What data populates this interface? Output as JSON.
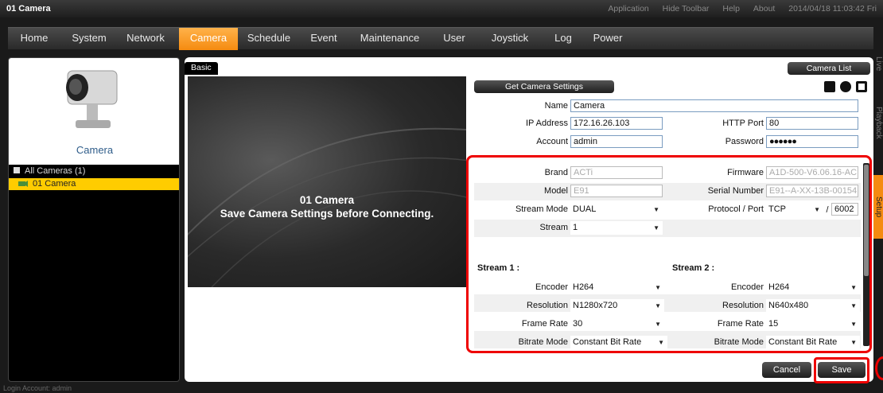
{
  "window": {
    "title": "01 Camera"
  },
  "toolbar_links": [
    "Application",
    "Hide Toolbar",
    "Help",
    "About"
  ],
  "datetime": "2014/04/18 11:03:42 Fri",
  "menu": [
    "Home",
    "System",
    "Network",
    "Camera",
    "Schedule",
    "Event",
    "Maintenance",
    "User",
    "Joystick",
    "Log",
    "Power"
  ],
  "active_menu": "Camera",
  "sidebar": {
    "camera_label": "Camera",
    "tree_root": "All Cameras (1)",
    "tree_item": "01  Camera"
  },
  "right_tabs": [
    "Live",
    "Playback",
    "Setup"
  ],
  "active_right_tab": "Setup",
  "basic_tab": "Basic",
  "camera_list_button": "Camera List",
  "preview": {
    "line1": "01 Camera",
    "line2": "Save Camera Settings before Connecting."
  },
  "get_settings_button": "Get Camera Settings",
  "form": {
    "name_label": "Name",
    "name_value": "Camera",
    "ip_label": "IP Address",
    "ip_value": "172.16.26.103",
    "http_port_label": "HTTP Port",
    "http_port_value": "80",
    "account_label": "Account",
    "account_value": "admin",
    "password_label": "Password",
    "password_value": "●●●●●●",
    "brand_label": "Brand",
    "brand_value": "ACTi",
    "firmware_label": "Firmware",
    "firmware_value": "A1D-500-V6.06.16-AC",
    "model_label": "Model",
    "model_value": "E91",
    "serial_label": "Serial Number",
    "serial_value": "E91--A-XX-13B-00154",
    "stream_mode_label": "Stream Mode",
    "stream_mode_value": "DUAL",
    "protocol_label": "Protocol / Port",
    "protocol_value": "TCP",
    "port_sep": "/",
    "port_value": "6002",
    "stream_label": "Stream",
    "stream_value": "1"
  },
  "stream1": {
    "heading": "Stream 1 :",
    "encoder_label": "Encoder",
    "encoder_value": "H264",
    "resolution_label": "Resolution",
    "resolution_value": "N1280x720",
    "framerate_label": "Frame Rate",
    "framerate_value": "30",
    "bitrate_label": "Bitrate Mode",
    "bitrate_value": "Constant Bit Rate"
  },
  "stream2": {
    "heading": "Stream 2 :",
    "encoder_label": "Encoder",
    "encoder_value": "H264",
    "resolution_label": "Resolution",
    "resolution_value": "N640x480",
    "framerate_label": "Frame Rate",
    "framerate_value": "15",
    "bitrate_label": "Bitrate Mode",
    "bitrate_value": "Constant Bit Rate"
  },
  "cancel_button": "Cancel",
  "save_button": "Save",
  "status": {
    "login": "Login Account: admin"
  },
  "colors": {
    "accent": "#f58b10",
    "highlight": "#ffcc00",
    "annotation": "#e00000",
    "link": "#2f5d8a"
  }
}
